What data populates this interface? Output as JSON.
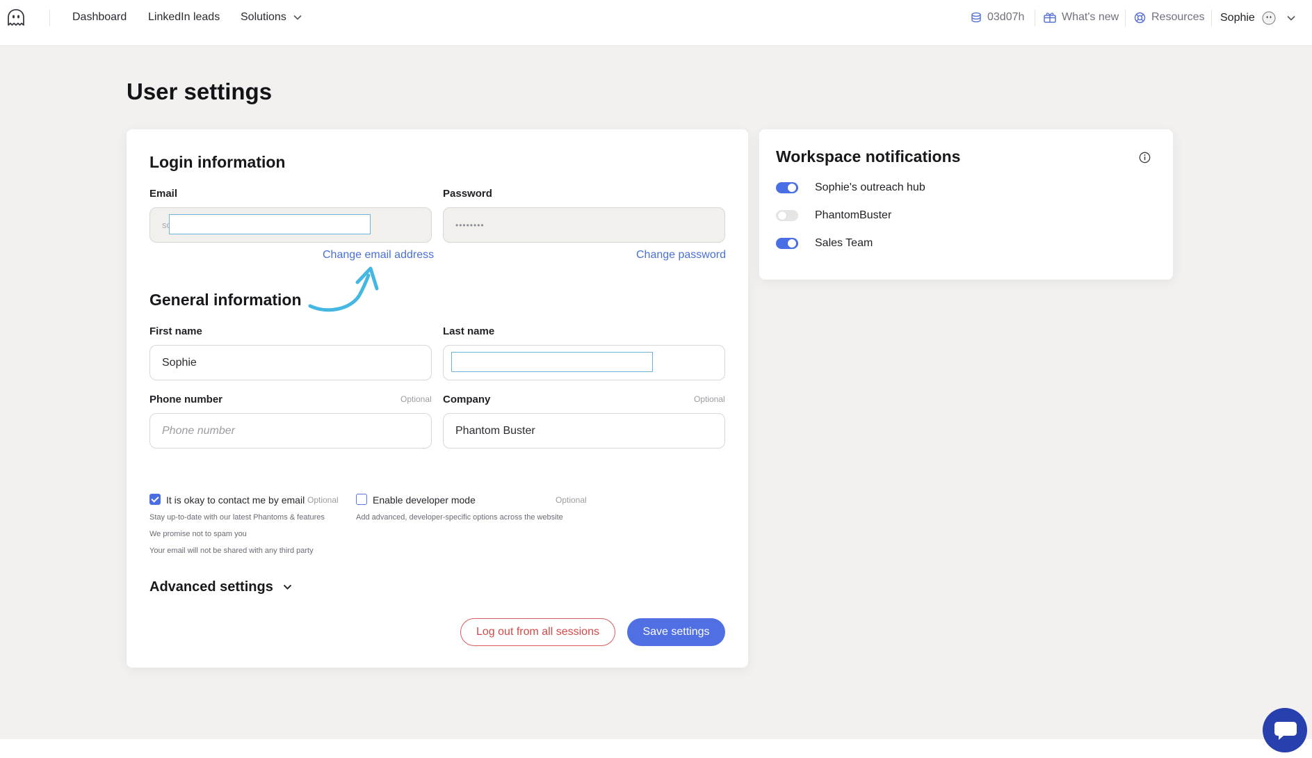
{
  "nav": {
    "dashboard": "Dashboard",
    "linkedin_leads": "LinkedIn leads",
    "solutions": "Solutions",
    "time_remaining": "03d07h",
    "whats_new": "What's new",
    "resources": "Resources",
    "user_name": "Sophie"
  },
  "page": {
    "title": "User settings"
  },
  "login": {
    "title": "Login information",
    "email_label": "Email",
    "email_value": "so",
    "password_label": "Password",
    "password_value": "••••••••",
    "change_email": "Change email address",
    "change_password": "Change password"
  },
  "general": {
    "title": "General information",
    "first_name_label": "First name",
    "first_name_value": "Sophie",
    "last_name_label": "Last name",
    "last_name_value": "",
    "phone_label": "Phone number",
    "phone_optional": "Optional",
    "phone_placeholder": "Phone number",
    "company_label": "Company",
    "company_optional": "Optional",
    "company_value": "Phantom Buster"
  },
  "consent": {
    "contact_label": "It is okay to contact me by email",
    "contact_optional": "Optional",
    "contact_checked": true,
    "contact_note_1": "Stay up-to-date with our latest Phantoms & features",
    "contact_note_2": "We promise not to spam you",
    "contact_note_3": "Your email will not be shared with any third party",
    "dev_label": "Enable developer mode",
    "dev_optional": "Optional",
    "dev_checked": false,
    "dev_note": "Add advanced, developer-specific options across the website"
  },
  "advanced": {
    "title": "Advanced settings"
  },
  "actions": {
    "logout_all": "Log out from all sessions",
    "save": "Save settings"
  },
  "notifications": {
    "title": "Workspace notifications",
    "items": [
      {
        "label": "Sophie's outreach hub",
        "enabled": true
      },
      {
        "label": "PhantomBuster",
        "enabled": false
      },
      {
        "label": "Sales Team",
        "enabled": true
      }
    ]
  },
  "colors": {
    "accent": "#4f6fe3",
    "danger": "#d24848",
    "link": "#4a6fd8",
    "annotation_arrow": "#45b7e3",
    "chat": "#283fae"
  },
  "icons": {
    "logo": "ghost-logo-icon",
    "solutions_chevron": "chevron-down-icon",
    "credits": "coins-icon",
    "whats_new": "gift-icon",
    "resources": "lifebuoy-icon",
    "avatar": "ghost-avatar-icon",
    "user_chevron": "chevron-down-icon",
    "info": "info-icon",
    "advanced_chevron": "chevron-down-icon",
    "chat": "chat-icon"
  }
}
